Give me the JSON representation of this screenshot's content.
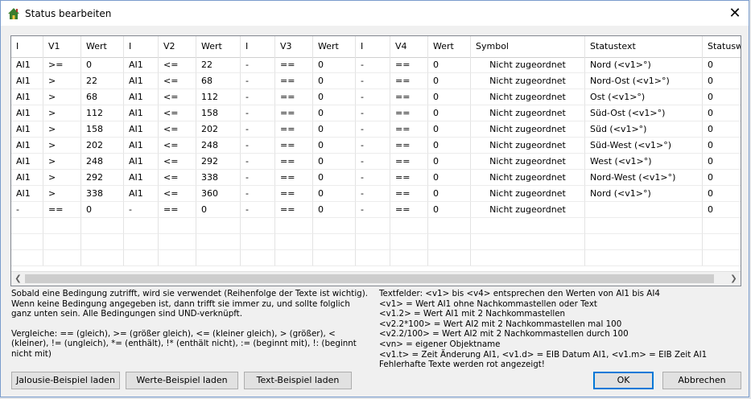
{
  "window": {
    "title": "Status bearbeiten",
    "close_glyph": "✕",
    "icon": "house-icon"
  },
  "table": {
    "columns": [
      "I",
      "V1",
      "Wert",
      "I",
      "V2",
      "Wert",
      "I",
      "V3",
      "Wert",
      "I",
      "V4",
      "Wert",
      "Symbol",
      "Statustext",
      "Statuswe"
    ],
    "rows": [
      [
        "AI1",
        ">=",
        "0",
        "AI1",
        "<=",
        "22",
        "-",
        "==",
        "0",
        "-",
        "==",
        "0",
        "Nicht zugeordnet",
        "Nord (<v1>°)",
        "0"
      ],
      [
        "AI1",
        ">",
        "22",
        "AI1",
        "<=",
        "68",
        "-",
        "==",
        "0",
        "-",
        "==",
        "0",
        "Nicht zugeordnet",
        "Nord-Ost (<v1>°)",
        "0"
      ],
      [
        "AI1",
        ">",
        "68",
        "AI1",
        "<=",
        "112",
        "-",
        "==",
        "0",
        "-",
        "==",
        "0",
        "Nicht zugeordnet",
        "Ost (<v1>°)",
        "0"
      ],
      [
        "AI1",
        ">",
        "112",
        "AI1",
        "<=",
        "158",
        "-",
        "==",
        "0",
        "-",
        "==",
        "0",
        "Nicht zugeordnet",
        "Süd-Ost (<v1>°)",
        "0"
      ],
      [
        "AI1",
        ">",
        "158",
        "AI1",
        "<=",
        "202",
        "-",
        "==",
        "0",
        "-",
        "==",
        "0",
        "Nicht zugeordnet",
        "Süd (<v1>°)",
        "0"
      ],
      [
        "AI1",
        ">",
        "202",
        "AI1",
        "<=",
        "248",
        "-",
        "==",
        "0",
        "-",
        "==",
        "0",
        "Nicht zugeordnet",
        "Süd-West (<v1>°)",
        "0"
      ],
      [
        "AI1",
        ">",
        "248",
        "AI1",
        "<=",
        "292",
        "-",
        "==",
        "0",
        "-",
        "==",
        "0",
        "Nicht zugeordnet",
        "West (<v1>°)",
        "0"
      ],
      [
        "AI1",
        ">",
        "292",
        "AI1",
        "<=",
        "338",
        "-",
        "==",
        "0",
        "-",
        "==",
        "0",
        "Nicht zugeordnet",
        "Nord-West (<v1>°)",
        "0"
      ],
      [
        "AI1",
        ">",
        "338",
        "AI1",
        "<=",
        "360",
        "-",
        "==",
        "0",
        "-",
        "==",
        "0",
        "Nicht zugeordnet",
        "Nord (<v1>°)",
        "0"
      ],
      [
        "-",
        "==",
        "0",
        "-",
        "==",
        "0",
        "-",
        "==",
        "0",
        "-",
        "==",
        "0",
        "Nicht zugeordnet",
        "",
        "0"
      ]
    ]
  },
  "scrollbar": {
    "left_arrow": "❮",
    "right_arrow": "❯"
  },
  "info_left": {
    "line1": "Sobald eine Bedingung zutrifft, wird sie verwendet (Reihenfolge der Texte ist wichtig). Wenn keine Bedingung angegeben ist, dann trifft sie immer zu, und sollte folglich ganz unten sein. Alle Bedingungen sind UND-verknüpft.",
    "line2": "Vergleiche: == (gleich), >= (größer gleich), <= (kleiner gleich), > (größer), < (kleiner), != (ungleich), *= (enthält), !* (enthält nicht), := (beginnt mit), !: (beginnt nicht mit)"
  },
  "info_right": {
    "lines": [
      "Textfelder: <v1> bis <v4> entsprechen den Werten von AI1 bis AI4",
      "<v1> = Wert AI1 ohne Nachkommastellen oder Text",
      "<v1.2> = Wert AI1 mit 2 Nachkommastellen",
      "<v2.2*100> = Wert AI2 mit 2 Nachkommastellen mal 100",
      "<v2.2/100> = Wert AI2 mit 2 Nachkommastellen durch 100",
      "<vn> = eigener Objektname",
      "<v1.t> = Zeit Änderung AI1, <v1.d> = EIB Datum AI1, <v1.m> = EIB Zeit AI1",
      "Fehlerhafte Texte werden rot angezeigt!"
    ]
  },
  "buttons": {
    "jalousie": "Jalousie-Beispiel laden",
    "werte": "Werte-Beispiel laden",
    "text": "Text-Beispiel laden",
    "ok": "OK",
    "abbrechen": "Abbrechen"
  }
}
